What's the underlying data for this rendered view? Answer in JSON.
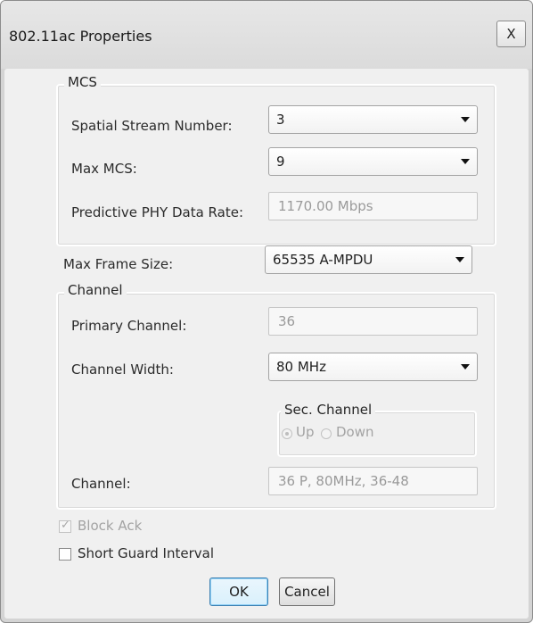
{
  "window": {
    "title": "802.11ac Properties",
    "close_label": "X"
  },
  "mcs": {
    "group_label": "MCS",
    "spatial_stream_label": "Spatial Stream Number:",
    "spatial_stream_value": "3",
    "max_mcs_label": "Max MCS:",
    "max_mcs_value": "9",
    "phy_rate_label": "Predictive PHY Data Rate:",
    "phy_rate_value": "1170.00 Mbps"
  },
  "frame": {
    "max_frame_size_label": "Max Frame Size:",
    "max_frame_size_value": "65535 A-MPDU"
  },
  "channel": {
    "group_label": "Channel",
    "primary_channel_label": "Primary Channel:",
    "primary_channel_value": "36",
    "channel_width_label": "Channel Width:",
    "channel_width_value": "80 MHz",
    "sec_channel_label": "Sec. Channel",
    "sec_up_label": "Up",
    "sec_down_label": "Down",
    "channel_label": "Channel:",
    "channel_value": "36 P, 80MHz, 36-48"
  },
  "options": {
    "block_ack_label": "Block Ack",
    "block_ack_checked": true,
    "short_gi_label": "Short Guard Interval",
    "short_gi_checked": false
  },
  "buttons": {
    "ok_label": "OK",
    "cancel_label": "Cancel"
  }
}
